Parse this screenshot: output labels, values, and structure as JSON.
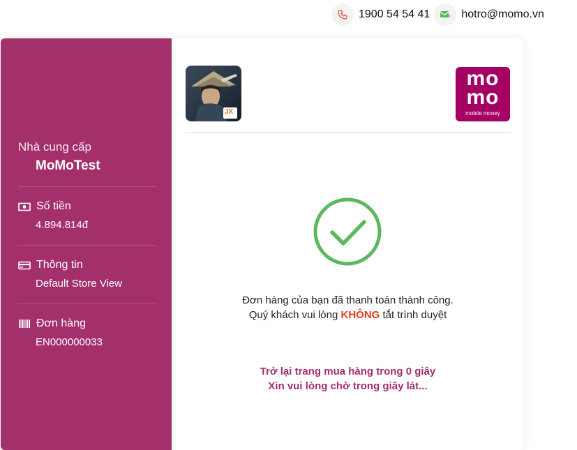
{
  "contact": {
    "phone": "1900 54 54 41",
    "email": "hotro@momo.vn",
    "phone_icon": "phone-icon",
    "email_icon": "mail-icon"
  },
  "sidebar": {
    "provider_label": "Nhà cung cấp",
    "provider_name": "MoMoTest",
    "amount_label": "Số tiền",
    "amount_value": "4.894.814đ",
    "info_label": "Thông tin",
    "info_value": "Default Store View",
    "order_label": "Đơn hàng",
    "order_value": "EN000000033"
  },
  "main": {
    "game_logo_text": "JX",
    "momo_logo_top": "mo",
    "momo_logo_bottom": "mo",
    "momo_logo_tagline": "mobile money",
    "success_message": "Đơn hàng của bạn đã thanh toán thành công.",
    "warning_prefix": "Quý khách vui lòng",
    "warning_emphasis": "KHÔNG",
    "warning_suffix": "tắt trình duyệt",
    "redirect_line1": "Trở lại trang mua hàng trong 0 giây",
    "redirect_line2": "Xin vui lòng chờ trong giây lát..."
  },
  "colors": {
    "brand": "#a3306b",
    "momo": "#a50064",
    "success": "#5cb85c",
    "warning": "#e53b1f"
  }
}
